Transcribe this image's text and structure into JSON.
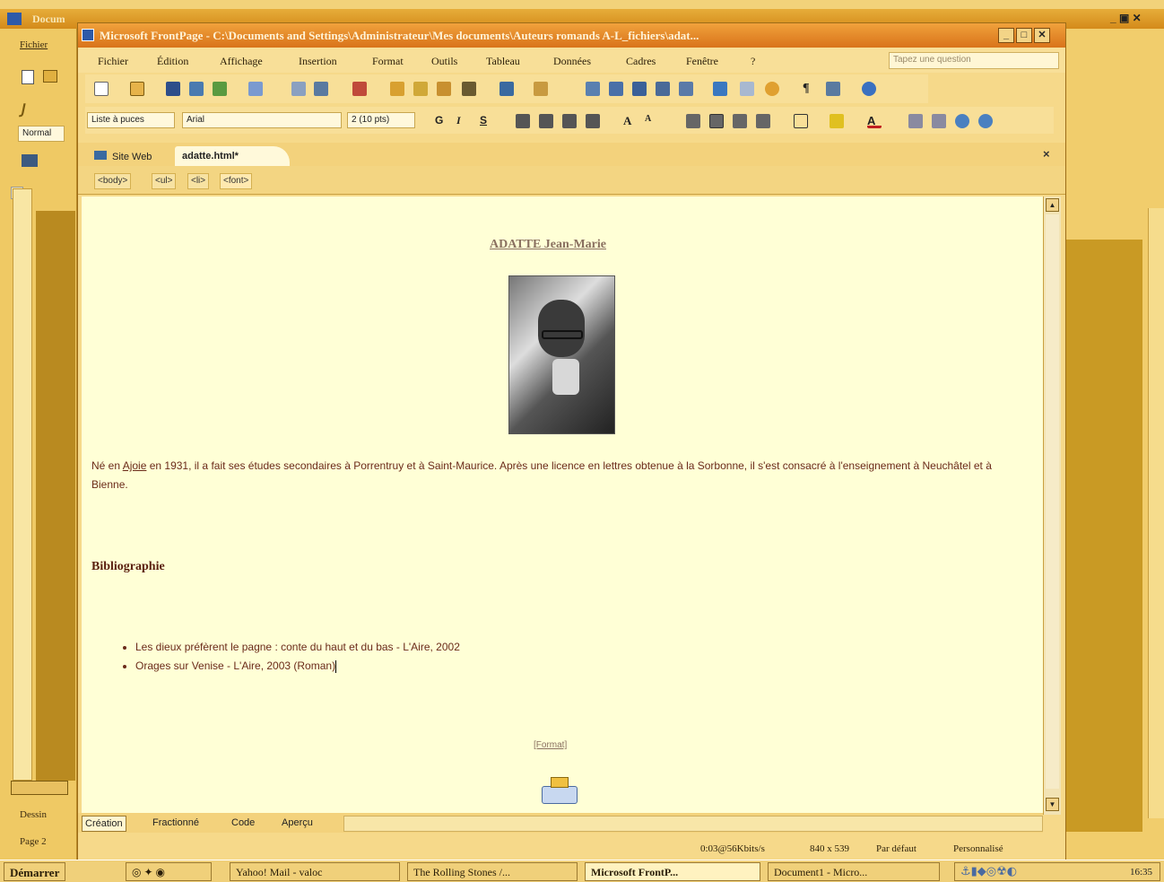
{
  "background_window": {
    "title": "Docum",
    "menu_label": "Fichier",
    "style_box": "Normal",
    "draw_label": "Dessin",
    "page_label": "Page 2"
  },
  "frontpage": {
    "title": "Microsoft FrontPage - C:\\Documents and Settings\\Administrateur\\Mes documents\\Auteurs romands A-L_fichiers\\adat...",
    "menus": [
      "Fichier",
      "Édition",
      "Affichage",
      "Insertion",
      "Format",
      "Outils",
      "Tableau",
      "Données",
      "Cadres",
      "Fenêtre",
      "?"
    ],
    "ask_placeholder": "Tapez une question",
    "style_combo": "Liste à puces",
    "font_combo": "Arial",
    "size_combo": "2 (10 pts)",
    "tabs": [
      "Site Web",
      "adatte.html*"
    ],
    "quick_tags": [
      "<body>",
      "<ul>",
      "<li>",
      "<font>"
    ],
    "view_tabs": [
      "Création",
      "Fractionné",
      "Code",
      "Aperçu"
    ],
    "status": {
      "speed": "0:03@56Kbits/s",
      "size": "840 x 539",
      "mode": "Par défaut",
      "custom": "Personnalisé"
    }
  },
  "document": {
    "heading": "ADATTE Jean-Marie",
    "paragraph_prefix": "Né en ",
    "paragraph_link": "Ajoie",
    "paragraph_rest": " en 1931, il a fait ses études secondaires à Porrentruy et à Saint-Maurice. Après une licence en lettres obtenue à la Sorbonne, il s'est consacré à l'enseignement à Neuchâtel et à Bienne.",
    "biblio_heading": "Bibliographie",
    "bibliography": [
      "Les dieux préfèrent le pagne : conte du haut et du bas  - L'Aire, 2002",
      "Orages sur Venise  - L'Aire, 2003 (Roman)"
    ],
    "footer_link": "[Format]"
  },
  "taskbar": {
    "start": "Démarrer",
    "items": [
      "Yahoo! Mail - valoc",
      "The Rolling Stones /...",
      "Microsoft FrontP...",
      "Document1 - Micro..."
    ],
    "clock": "16:35"
  },
  "colors": {
    "title_orange": "#d9731a",
    "doc_bg": "#ffffd6",
    "text_brown": "#6b2b1a"
  }
}
